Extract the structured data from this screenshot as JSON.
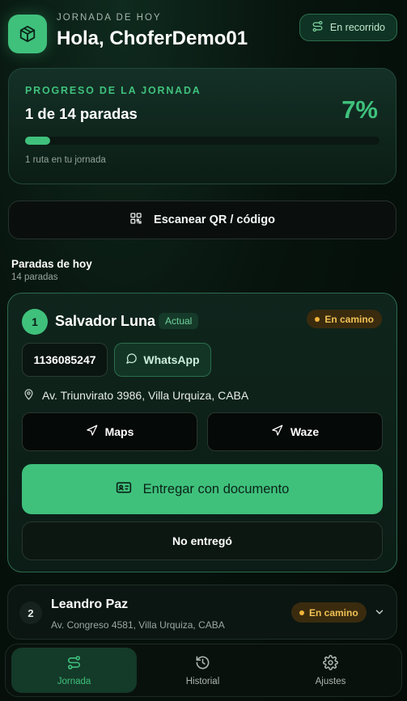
{
  "header": {
    "kicker": "JORNADA DE HOY",
    "greeting": "Hola, ChoferDemo01",
    "status_label": "En recorrido",
    "logo_icon": "package-icon",
    "status_icon": "route-icon"
  },
  "progress": {
    "label": "PROGRESO DE LA JORNADA",
    "stops_text": "1 de 14 paradas",
    "percent_text": "7%",
    "percent_value": 7,
    "subtitle": "1 ruta en tu jornada"
  },
  "scan": {
    "label": "Escanear QR / código",
    "icon": "qr-icon"
  },
  "stops_section": {
    "title": "Paradas de hoy",
    "count_text": "14 paradas"
  },
  "current_stop": {
    "number": "1",
    "name": "Salvador Luna",
    "tag": "Actual",
    "status": "En camino",
    "phone": "1136085247",
    "whatsapp_label": "WhatsApp",
    "address": "Av. Triunvirato 3986, Villa Urquiza, CABA",
    "maps_label": "Maps",
    "waze_label": "Waze",
    "deliver_label": "Entregar con documento",
    "not_delivered_label": "No entregó"
  },
  "next_stop": {
    "number": "2",
    "name": "Leandro Paz",
    "address": "Av. Congreso 4581, Villa Urquiza, CABA",
    "status": "En camino"
  },
  "bottom_nav": {
    "items": [
      {
        "label": "Jornada",
        "icon": "route-icon",
        "active": true
      },
      {
        "label": "Historial",
        "icon": "history-icon",
        "active": false
      },
      {
        "label": "Ajustes",
        "icon": "gear-icon",
        "active": false
      }
    ]
  },
  "colors": {
    "accent": "#3fc17c",
    "status_amber": "#f0c155",
    "background": "#06100b"
  }
}
